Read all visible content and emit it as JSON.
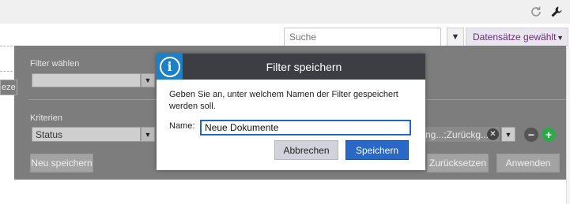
{
  "toolbar": {
    "refresh_icon": "refresh-icon",
    "settings_icon": "wrench-icon"
  },
  "search": {
    "placeholder": "Suche",
    "value": ""
  },
  "records_dropdown": {
    "label": "Datensätze gewählt",
    "color": "#6a2a7a"
  },
  "left_tab": {
    "label": "eze"
  },
  "filter_panel": {
    "select_filter_label": "Filter wählen",
    "select_filter_value": "",
    "criteria_label": "Kriterien",
    "criteria_value": "Status",
    "criteria_selection": "ng...;Zurückg...",
    "save_new_button": "Neu speichern",
    "reset_button": "Zurücksetzen",
    "apply_button": "Anwenden"
  },
  "dialog": {
    "title": "Filter speichern",
    "message": "Geben Sie an, unter welchem Namen der Filter gespeichert werden soll.",
    "name_label": "Name:",
    "name_value": "Neue Dokumente",
    "cancel_button": "Abbrechen",
    "save_button": "Speichern",
    "accent_color": "#1e7fc4",
    "primary_color": "#2a68c8"
  }
}
